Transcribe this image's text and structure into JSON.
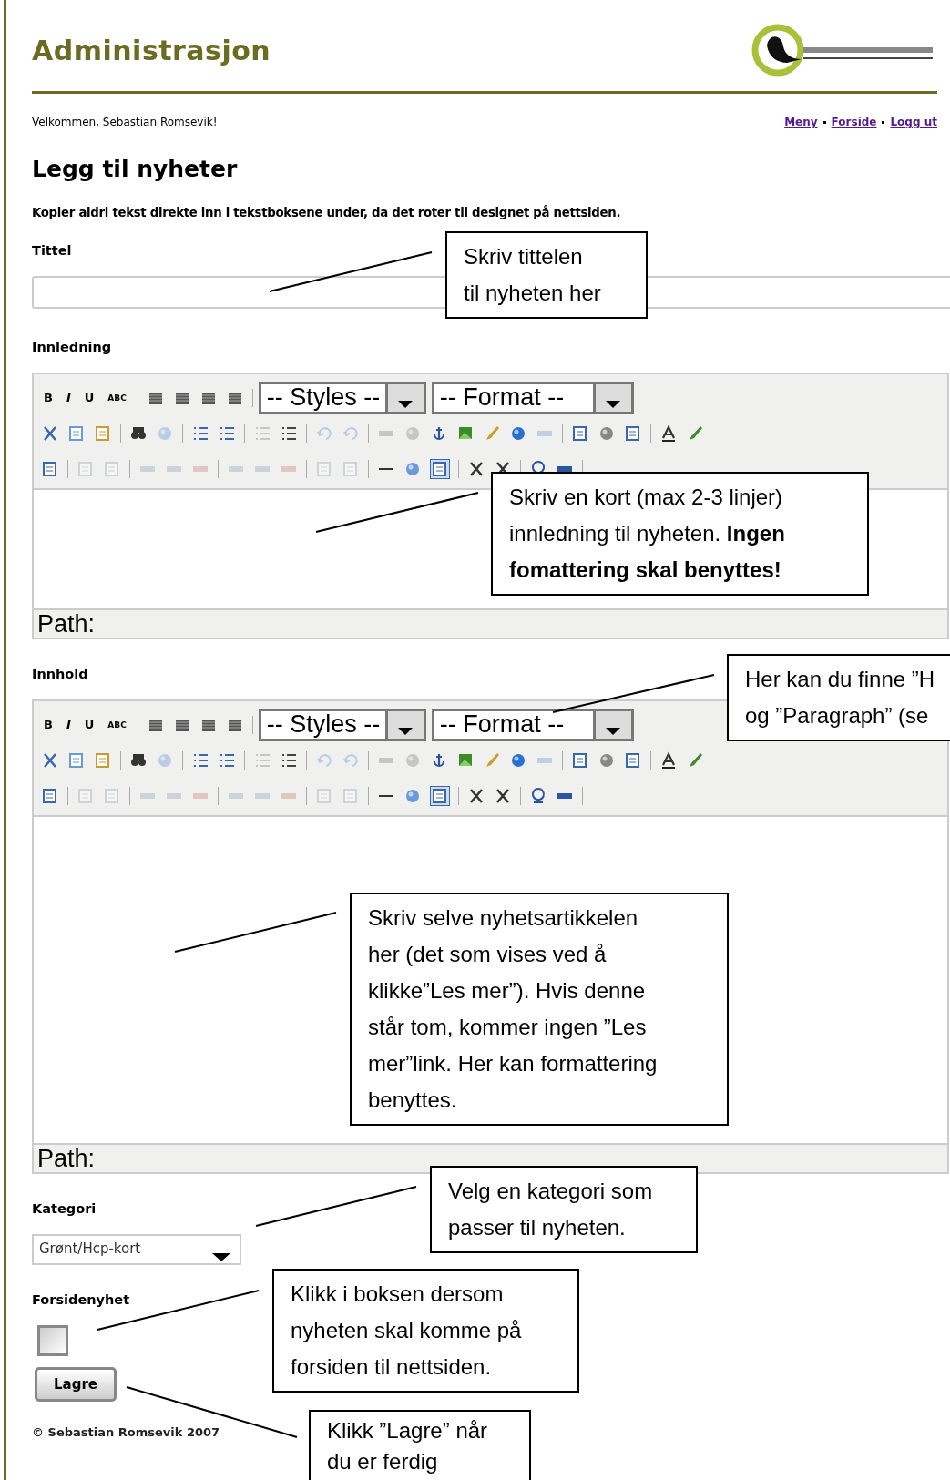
{
  "header": {
    "title": "Administrasjon"
  },
  "welcome": "Velkommen, Sebastian Romsevik!",
  "nav_links": [
    "Meny",
    "Forside",
    "Logg ut"
  ],
  "page_title": "Legg til nyheter",
  "warning": "Kopier aldri tekst direkte inn i tekstboksene under, da det roter til designet på nettsiden.",
  "title_field": {
    "label": "Tittel"
  },
  "editors": [
    {
      "label": "Innledning",
      "buttons": [
        "B",
        "I",
        "U",
        "ABC"
      ],
      "styles": "-- Styles --",
      "format": "-- Format --",
      "path": "Path:"
    },
    {
      "label": "Innhold",
      "buttons": [
        "B",
        "I",
        "U",
        "ABC"
      ],
      "styles": "-- Styles --",
      "format": "-- Format --",
      "path": "Path:"
    }
  ],
  "category": {
    "label": "Kategori",
    "value": "Grønt/Hcp-kort"
  },
  "front_page": {
    "label": "Forsidenyhet",
    "checked": false
  },
  "save_button": "Lagre",
  "footer": "© Sebastian Romsevik 2007",
  "callouts": [
    {
      "lines": [
        "Skriv tittelen",
        "til nyheten her"
      ]
    },
    {
      "lines": [
        "Skriv en kort (max 2-3 linjer)",
        "innledning til nyheten. **Ingen**",
        "**fomattering skal benyttes!**"
      ]
    },
    {
      "lines": [
        "Her kan du finne ”H",
        "og ”Paragraph” (se"
      ]
    },
    {
      "lines": [
        "Skriv selve nyhetsartikkelen",
        "her (det som vises ved å",
        "klikke”Les mer”). Hvis denne",
        "står tom, kommer ingen ”Les",
        "mer”link. Her kan formattering",
        "benyttes."
      ]
    },
    {
      "lines": [
        "Velg en kategori som",
        "passer til nyheten."
      ]
    },
    {
      "lines": [
        "Klikk i boksen dersom",
        "nyheten skal komme på",
        "forsiden til nettsiden."
      ]
    },
    {
      "lines": [
        "Klikk ”Lagre” når",
        "du er ferdig"
      ]
    }
  ]
}
